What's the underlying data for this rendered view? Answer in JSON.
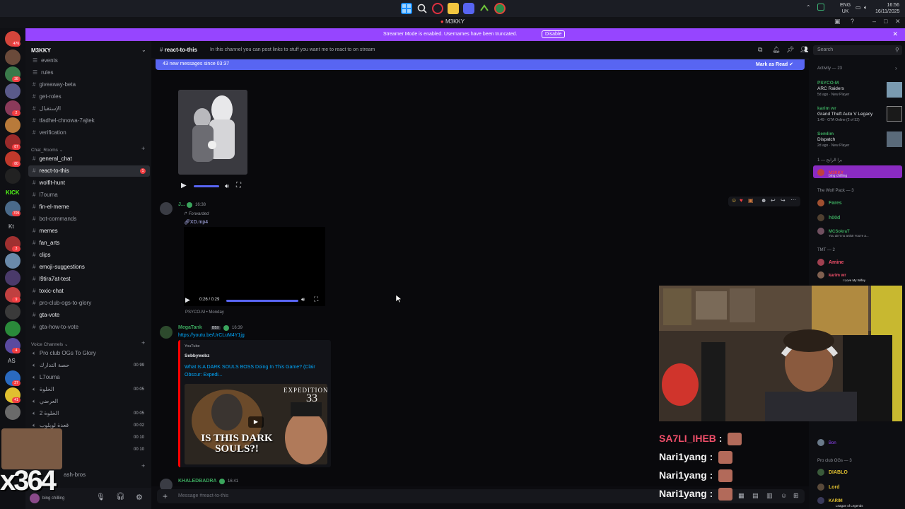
{
  "taskbar": {
    "lang_top": "ENG",
    "lang_bottom": "UK",
    "time": "16:56",
    "date": "16/11/2025"
  },
  "window": {
    "title": "M3KKY"
  },
  "banner": {
    "message": "Streamer Mode is enabled. Usernames have been truncated.",
    "disable_label": "Disable"
  },
  "rail": {
    "badges": [
      "476",
      "38",
      "2",
      "87",
      "80",
      "709",
      "3",
      "9",
      "4",
      "27",
      "41"
    ],
    "labels": [
      "Kt",
      "AS"
    ]
  },
  "sidebar": {
    "server_name": "M3KKY",
    "channels_top": [
      {
        "name": "events",
        "kind": "text"
      },
      {
        "name": "rules",
        "kind": "text"
      },
      {
        "name": "giveaway-beta",
        "kind": "text"
      },
      {
        "name": "get-roles",
        "kind": "text"
      },
      {
        "name": "الإستقبال",
        "kind": "text"
      },
      {
        "name": "tfadhel-chnowa-7ajtek",
        "kind": "text"
      },
      {
        "name": "verification",
        "kind": "text"
      }
    ],
    "chat_rooms_label": "Chat_Rooms",
    "chat_channels": [
      {
        "name": "general_chat",
        "active": false
      },
      {
        "name": "react-to-this",
        "active": true,
        "mention": "1"
      },
      {
        "name": "wolfit-hunt",
        "active": false
      },
      {
        "name": "l7ouma",
        "active": false
      },
      {
        "name": "fin-el-meme",
        "active": false
      },
      {
        "name": "bot-commands",
        "active": false
      },
      {
        "name": "memes",
        "active": false
      },
      {
        "name": "fan_arts",
        "active": false
      },
      {
        "name": "clips",
        "active": false
      },
      {
        "name": "emoji-suggestions",
        "active": false
      },
      {
        "name": "l9tira7at-test",
        "active": false
      },
      {
        "name": "toxic-chat",
        "active": false
      },
      {
        "name": "pro-club-ogs-to-glory",
        "active": false
      },
      {
        "name": "gta-vote",
        "active": false
      },
      {
        "name": "gta-how-to-vote",
        "active": false
      }
    ],
    "voice_label": "Voice Channels",
    "voice_channels": [
      {
        "name": "Pro club OGs To Glory",
        "count": ""
      },
      {
        "name": "حصة التدارك",
        "count": "00 99"
      },
      {
        "name": "L7ouma",
        "count": ""
      },
      {
        "name": "الخلوة",
        "count": "00 05"
      },
      {
        "name": "العرضي",
        "count": ""
      },
      {
        "name": "الخلوة 2",
        "count": "00 05"
      },
      {
        "name": "قعدة لوبلوب",
        "count": "00 02"
      },
      {
        "name": "",
        "count": "00 10"
      },
      {
        "name": "",
        "count": "00 10"
      }
    ],
    "bottom_channel": "ash-bros",
    "user_status": "bing chilling"
  },
  "header": {
    "channel_name": "react-to-this",
    "topic": "In this channel you can post links to stuff you want me to react to on stream",
    "search_placeholder": "Search"
  },
  "new_messages": {
    "text": "43 new messages since 03:37",
    "mark_read": "Mark as Read"
  },
  "messages": {
    "msg1": {
      "author": "J...",
      "time": "16:38",
      "forwarded": "Forwarded",
      "file": "XD.mp4",
      "video_time": "0:26 / 0:29",
      "footer": "PSYCO-M • Monday"
    },
    "msg2": {
      "author": "MegaTank",
      "tag": "BBX",
      "time": "16:39",
      "link": "https://youtu.be/UrCLuM4Y1jg",
      "provider": "YouTube",
      "channel": "Sebbywebz",
      "title": "What Is A DARK SOULS BOSS Doing In This Game? (Clair Obscur: Expedi...",
      "thumb_tag": "EXPEDITION",
      "thumb_num": "33",
      "thumb_caption": "IS THIS DARK SOULS?!"
    },
    "msg3": {
      "author": "KHALEDBADRA",
      "time": "16:41"
    }
  },
  "composer": {
    "placeholder": "Message #react-to-this"
  },
  "activity": {
    "header": "Activity — 23",
    "items": [
      {
        "name": "PSYCO-M",
        "game": "ARC Raiders",
        "meta": "5d ago · New Player"
      },
      {
        "name": "karim wr",
        "game": "Grand Theft Auto V Legacy",
        "meta": "1:49 · GTA Online (2 of 32)"
      },
      {
        "name": "Semlim",
        "game": "Dispatch",
        "meta": "2d ago · New Player"
      }
    ],
    "group1_label": "برا الرابح — 1",
    "group1_member": "M3KKY",
    "group1_status": "bing chilling",
    "wolfpack_label": "The Wolf Pack — 3",
    "wolfpack": [
      "Fares",
      "h00d",
      "MCSokraT"
    ],
    "wolfpack_sub": "You ain't no artist! You're a...",
    "tmt_label": "TMT — 2",
    "tmt": [
      "Amine",
      "karim wr"
    ],
    "tmt_sub": "I Love My Wifey",
    "proclub_label": "Pro club OGs — 3",
    "proclub": [
      "DIABLO",
      "Lord",
      "KARIM"
    ],
    "proclub_sub": "League of Legends",
    "extra_member": "Bon"
  },
  "stream_chat": [
    {
      "name": "SA7LI_IHEB",
      "color": "#f04f6a"
    },
    {
      "name": "Nari1yang",
      "color": "#f4f4f4"
    },
    {
      "name": "Nari1yang",
      "color": "#f4f4f4"
    },
    {
      "name": "Nari1yang",
      "color": "#f4f4f4"
    }
  ],
  "overlay": {
    "counter": "x364"
  },
  "colors": {
    "accent": "#5865f2",
    "streamer_banner": "#9645ff",
    "mention": "#f23f43",
    "online": "#23a55a"
  }
}
